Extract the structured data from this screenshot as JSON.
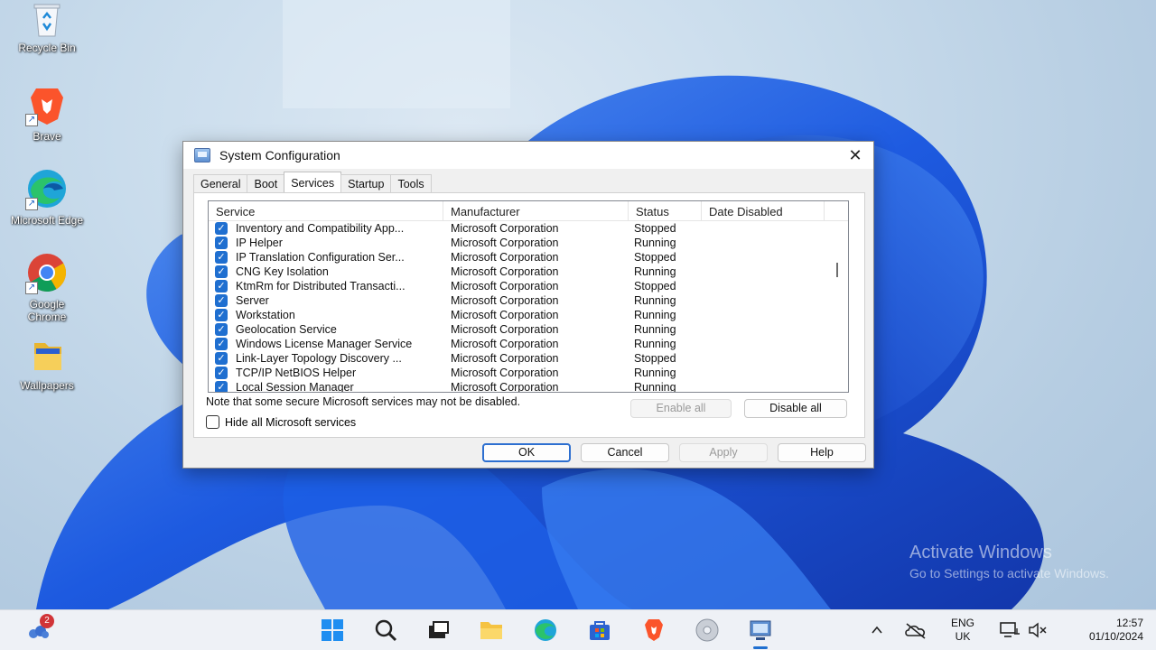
{
  "desktop": {
    "icons": [
      {
        "label": "Recycle Bin",
        "icon": "recycle-bin-icon"
      },
      {
        "label": "Brave",
        "icon": "brave-icon"
      },
      {
        "label": "Microsoft Edge",
        "icon": "edge-icon"
      },
      {
        "label": "Google Chrome",
        "icon": "chrome-icon"
      },
      {
        "label": "Wallpapers",
        "icon": "folder-icon"
      }
    ]
  },
  "dialog": {
    "title": "System Configuration",
    "close_glyph": "✕",
    "tabs": [
      {
        "label": "General",
        "active": false
      },
      {
        "label": "Boot",
        "active": false
      },
      {
        "label": "Services",
        "active": true
      },
      {
        "label": "Startup",
        "active": false
      },
      {
        "label": "Tools",
        "active": false
      }
    ],
    "columns": [
      "Service",
      "Manufacturer",
      "Status",
      "Date Disabled"
    ],
    "rows": [
      {
        "service": "Inventory and Compatibility App...",
        "manufacturer": "Microsoft Corporation",
        "status": "Stopped",
        "date": "",
        "checked": true
      },
      {
        "service": "IP Helper",
        "manufacturer": "Microsoft Corporation",
        "status": "Running",
        "date": "",
        "checked": true
      },
      {
        "service": "IP Translation Configuration Ser...",
        "manufacturer": "Microsoft Corporation",
        "status": "Stopped",
        "date": "",
        "checked": true
      },
      {
        "service": "CNG Key Isolation",
        "manufacturer": "Microsoft Corporation",
        "status": "Running",
        "date": "",
        "checked": true
      },
      {
        "service": "KtmRm for Distributed Transacti...",
        "manufacturer": "Microsoft Corporation",
        "status": "Stopped",
        "date": "",
        "checked": true
      },
      {
        "service": "Server",
        "manufacturer": "Microsoft Corporation",
        "status": "Running",
        "date": "",
        "checked": true
      },
      {
        "service": "Workstation",
        "manufacturer": "Microsoft Corporation",
        "status": "Running",
        "date": "",
        "checked": true
      },
      {
        "service": "Geolocation Service",
        "manufacturer": "Microsoft Corporation",
        "status": "Running",
        "date": "",
        "checked": true
      },
      {
        "service": "Windows License Manager Service",
        "manufacturer": "Microsoft Corporation",
        "status": "Running",
        "date": "",
        "checked": true
      },
      {
        "service": "Link-Layer Topology Discovery ...",
        "manufacturer": "Microsoft Corporation",
        "status": "Stopped",
        "date": "",
        "checked": true
      },
      {
        "service": "TCP/IP NetBIOS Helper",
        "manufacturer": "Microsoft Corporation",
        "status": "Running",
        "date": "",
        "checked": true
      },
      {
        "service": "Local Session Manager",
        "manufacturer": "Microsoft Corporation",
        "status": "Running",
        "date": "",
        "checked": true
      }
    ],
    "note": "Note that some secure Microsoft services may not be disabled.",
    "enable_all": "Enable all",
    "disable_all": "Disable all",
    "hide_ms": "Hide all Microsoft services",
    "ok": "OK",
    "cancel": "Cancel",
    "apply": "Apply",
    "help": "Help"
  },
  "watermark": {
    "line1": "Activate Windows",
    "line2": "Go to Settings to activate Windows."
  },
  "taskbar": {
    "weather_badge": "2",
    "lang_line1": "ENG",
    "lang_line2": "UK",
    "time": "12:57",
    "date": "01/10/2024",
    "icons": [
      "start-icon",
      "search-icon",
      "task-view-icon",
      "file-explorer-icon",
      "edge-icon",
      "store-icon",
      "brave-icon",
      "disc-icon",
      "system-config-icon"
    ]
  },
  "colors": {
    "accent": "#1f6fd0",
    "wallpaper_blue": "#1a5fe0"
  }
}
